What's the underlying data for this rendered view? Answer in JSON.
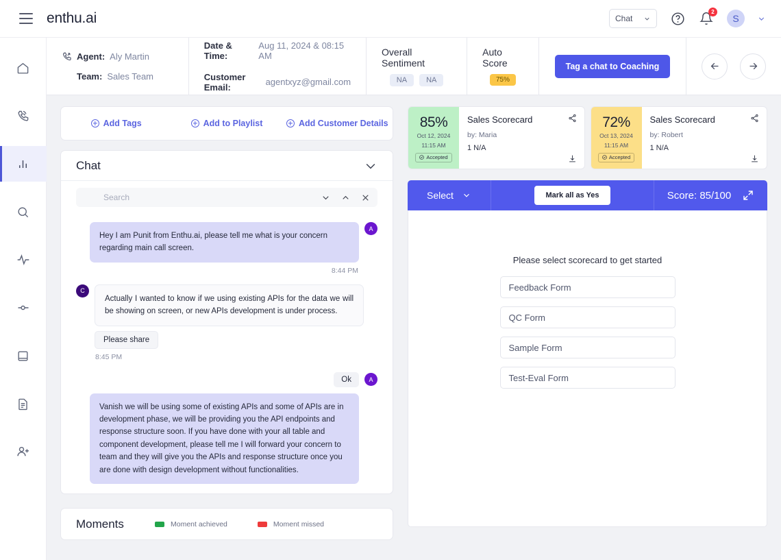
{
  "topbar": {
    "brand": "enthu.ai",
    "menu_icon": "hamburger-icon",
    "chat_select": "Chat",
    "help_icon": "question-circle-icon",
    "notifications_count": "2",
    "avatar_initial": "S"
  },
  "sidebar": {
    "items": [
      {
        "name": "home",
        "icon": "home-icon"
      },
      {
        "name": "calls",
        "icon": "phone-call-icon"
      },
      {
        "name": "analytics",
        "icon": "bar-chart-icon",
        "active": true
      },
      {
        "name": "search",
        "icon": "search-icon"
      },
      {
        "name": "activity",
        "icon": "pulse-icon"
      },
      {
        "name": "settings",
        "icon": "slider-icon"
      },
      {
        "name": "library",
        "icon": "book-icon"
      },
      {
        "name": "reports",
        "icon": "document-icon"
      },
      {
        "name": "add-user",
        "icon": "user-plus-icon"
      }
    ]
  },
  "meta": {
    "agent_label": "Agent:",
    "agent_value": "Aly Martin",
    "team_label": "Team:",
    "team_value": "Sales Team",
    "date_label": "Date & Time:",
    "date_value": "Aug 11, 2024 & 08:15 AM",
    "email_label": "Customer Email:",
    "email_value": "agentxyz@gmail.com",
    "sentiment_title": "Overall Sentiment",
    "sentiment_chips": [
      "NA",
      "NA"
    ],
    "autoscore_title": "Auto Score",
    "autoscore_value": "75%",
    "tag_button": "Tag a chat to Coaching",
    "prev_icon": "arrow-left-icon",
    "next_icon": "arrow-right-icon"
  },
  "actions": [
    {
      "label": "Add Tags",
      "name": "add-tags"
    },
    {
      "label": "Add to Playlist",
      "name": "add-to-playlist"
    },
    {
      "label": "Add Customer Details",
      "name": "add-customer-details"
    }
  ],
  "chat": {
    "title": "Chat",
    "collapse_icon": "chevron-down-icon",
    "search_placeholder": "Search",
    "search_value": "",
    "nav_down_icon": "chevron-down-icon",
    "nav_up_icon": "chevron-up-icon",
    "close_icon": "close-icon",
    "messages": [
      {
        "side": "out",
        "avatar": "A",
        "text": "Hey I am Punit from Enthu.ai, please tell me what is your concern regarding main call screen.",
        "time": "8:44 PM"
      },
      {
        "side": "in",
        "avatar": "C",
        "text": "Actually I wanted to know if we using existing APIs for the data we will be showing on screen, or new APIs development is under process.",
        "pill": "Please share",
        "time": "8:45 PM"
      },
      {
        "side": "out",
        "avatar": "A",
        "short": "Ok",
        "text": "Vanish we will be using some of existing APIs and some of APIs are in development phase, we will be providing you the API endpoints and response structure soon. If you have done with your all table and component development, please tell me I will forward your concern to team and they will give you the APIs and response structure once you are done with design development without functionalities.",
        "time": ""
      }
    ]
  },
  "moments": {
    "title": "Moments",
    "legend": [
      {
        "label": "Moment achieved",
        "color": "#22a54a"
      },
      {
        "label": "Moment missed",
        "color": "#ee3b3b"
      }
    ]
  },
  "scorecards": [
    {
      "percent": "85%",
      "date": "Oct 12, 2024",
      "time": "11:15 AM",
      "status": "Accepted",
      "title": "Sales Scorecard",
      "by": "by: Maria",
      "na": "1 N/A",
      "tone": "green",
      "share_icon": "share-icon",
      "download_icon": "download-icon"
    },
    {
      "percent": "72%",
      "date": "Oct 13, 2024",
      "time": "11:15 AM",
      "status": "Accepted",
      "title": "Sales Scorecard",
      "by": "by: Robert",
      "na": "1 N/A",
      "tone": "yellow",
      "share_icon": "share-icon",
      "download_icon": "download-icon"
    }
  ],
  "scorepanel": {
    "select_label": "Select",
    "select_caret": "chevron-down-icon",
    "mark_all_label": "Mark all as Yes",
    "score_label": "Score: 85/100",
    "expand_icon": "collapse-arrows-icon",
    "prompt": "Please select scorecard to get started",
    "forms": [
      "Feedback Form",
      "QC Form",
      "Sample Form",
      "Test-Eval Form"
    ]
  },
  "colors": {
    "accent": "#5159ec",
    "link": "#5b65e0",
    "green": "#bdf0c6",
    "yellow": "#fcdf88",
    "warning": "#fbc647",
    "page_bg": "#f1f2f5"
  }
}
